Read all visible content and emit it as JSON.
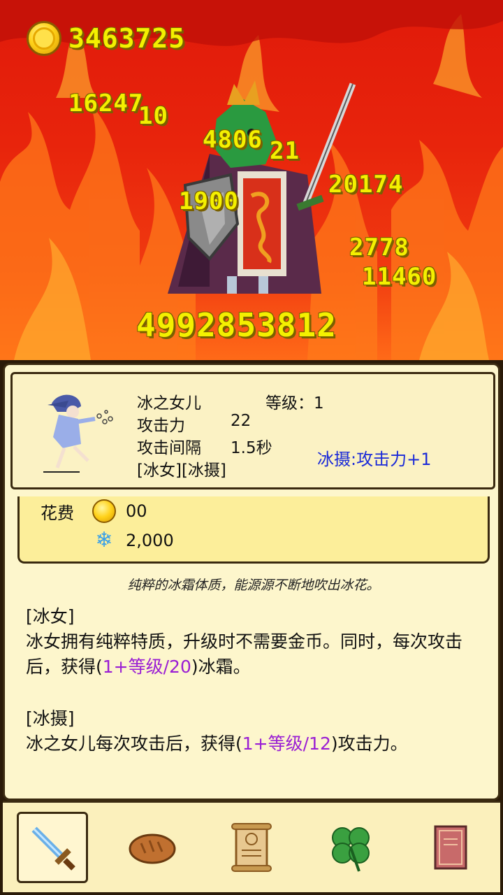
{
  "gold": "3463725",
  "damage_popups": [
    "16247",
    "10",
    "4806",
    "21",
    "20174",
    "1900",
    "2778",
    "11460"
  ],
  "total_damage": "4992853812",
  "hero": {
    "name": "冰之女儿",
    "level_label": "等级：1",
    "attack_label": "攻击力",
    "attack_value": "22",
    "interval_label": "攻击间隔",
    "interval_value": "1.5秒",
    "tags": "[冰女][冰摄]",
    "buff": "冰摄:攻击力+1"
  },
  "cost": {
    "label": "花费",
    "gold": "00",
    "frost": "2,000"
  },
  "flavor": "纯粹的冰霜体质，能源源不断地吹出冰花。",
  "skills": [
    {
      "title": "[冰女]",
      "text_before": "冰女拥有纯粹特质，升级时不需要金币。同时，每次攻击后，获得(",
      "formula": "1+等级/20",
      "text_after": ")冰霜。"
    },
    {
      "title": "[冰摄]",
      "text_before": "冰之女儿每次攻击后，获得(",
      "formula": "1+等级/12",
      "text_after": ")攻击力。"
    }
  ],
  "nav": [
    {
      "icon": "sword-icon",
      "active": true
    },
    {
      "icon": "bread-icon",
      "active": false
    },
    {
      "icon": "scroll-icon",
      "active": false
    },
    {
      "icon": "clover-icon",
      "active": false
    },
    {
      "icon": "book-icon",
      "active": false
    }
  ],
  "colors": {
    "buff": "#1a2ad8",
    "formula": "#9a1ed4",
    "damage": "#f4f000"
  }
}
